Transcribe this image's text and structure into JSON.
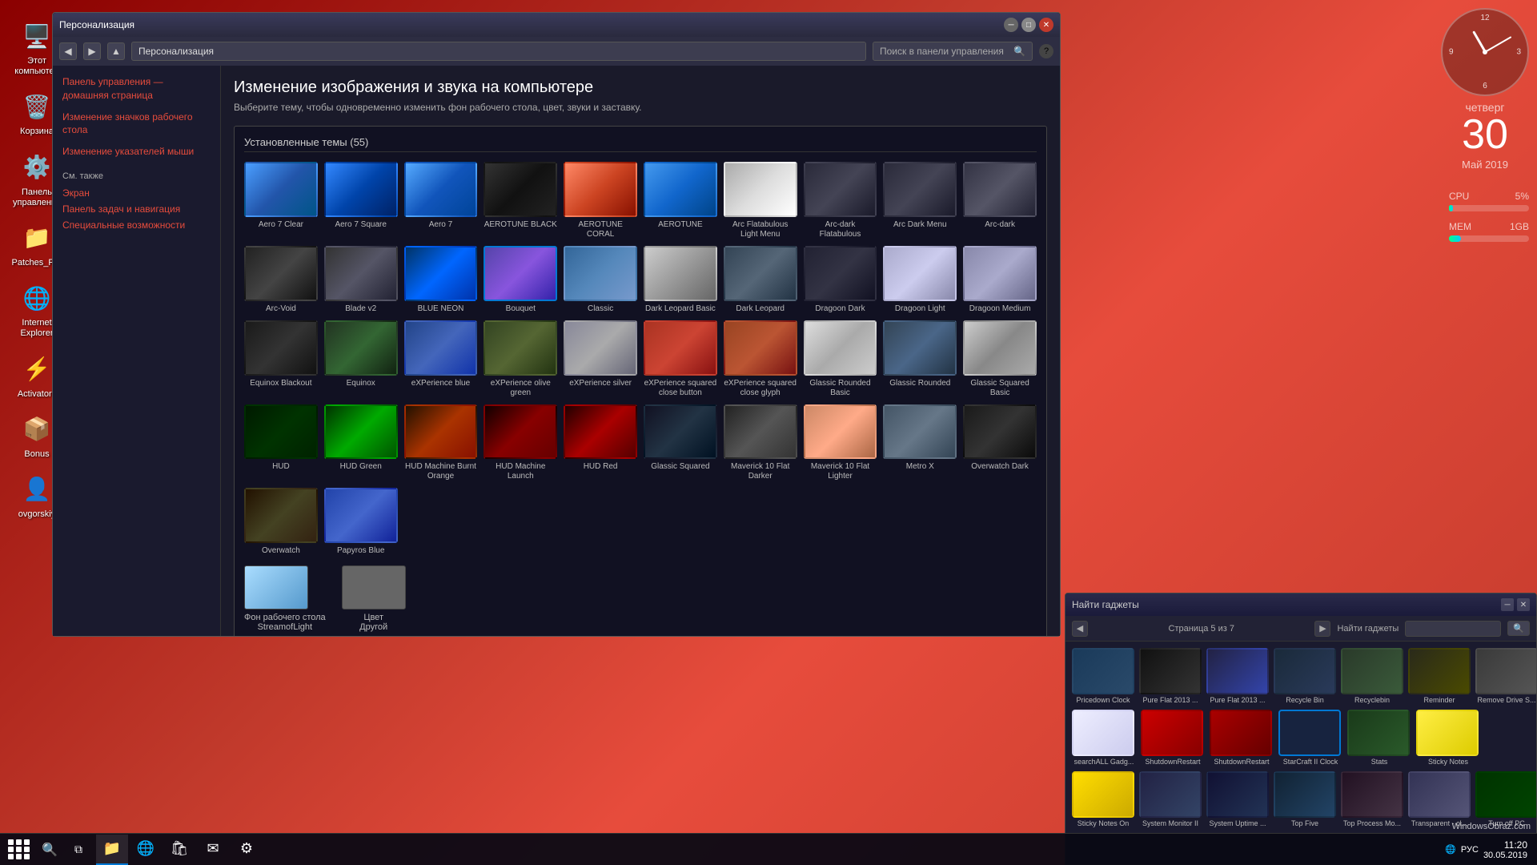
{
  "desktop": {
    "icons": [
      {
        "name": "this-computer",
        "label": "Этот компьютер",
        "icon": "🖥"
      },
      {
        "name": "basket",
        "label": "Корзина",
        "icon": "🗑"
      },
      {
        "name": "control-panel",
        "label": "Панель управления",
        "icon": "⚙"
      },
      {
        "name": "patches-fix",
        "label": "Patches_FIX",
        "icon": "📁"
      },
      {
        "name": "internet-explorer",
        "label": "Internet Explorer",
        "icon": "🌐"
      },
      {
        "name": "activators",
        "label": "Activators",
        "icon": "⚡"
      },
      {
        "name": "bonus",
        "label": "Bonus",
        "icon": "📦"
      },
      {
        "name": "ovgorskiy",
        "label": "ovgorskiy",
        "icon": "👤"
      }
    ]
  },
  "clock": {
    "day_label": "четверг",
    "date": "30",
    "month": "Май 2019"
  },
  "cpu": {
    "label": "CPU",
    "value": "5",
    "unit": "%",
    "fill_percent": 5
  },
  "mem": {
    "label": "MEM",
    "value": "1",
    "unit": "GB",
    "fill_percent": 15
  },
  "window": {
    "title": "Персонализация",
    "address": "Персонализация",
    "search_placeholder": "Поиск в панели управления",
    "help_btn": "?",
    "page_title": "Изменение изображения и звука на компьютере",
    "page_subtitle": "Выберите тему, чтобы одновременно изменить фон рабочего стола, цвет, звуки и заставку.",
    "themes_header": "Установленные темы (55)",
    "sidebar": {
      "home_link": "Панель управления — домашняя страница",
      "icons_link": "Изменение значков рабочего стола",
      "cursor_link": "Изменение указателей мыши",
      "see_also_label": "См. также",
      "screen_link": "Экран",
      "taskbar_link": "Панель задач и навигация",
      "accessibility_link": "Специальные возможности"
    },
    "themes": [
      {
        "id": "aero7clear",
        "name": "Aero 7 Clear",
        "css": "t-aero7clear",
        "selected": false
      },
      {
        "id": "aero7sq",
        "name": "Aero 7 Square",
        "css": "t-aero7sq",
        "selected": false
      },
      {
        "id": "aero7",
        "name": "Aero 7",
        "css": "t-aero7",
        "selected": false
      },
      {
        "id": "aeroblack",
        "name": "AEROTUNE BLACK",
        "css": "t-aeroblack",
        "selected": false
      },
      {
        "id": "aerocoral",
        "name": "AEROTUNE CORAL",
        "css": "t-aerocoral",
        "selected": false
      },
      {
        "id": "aerotune",
        "name": "AEROTUNE",
        "css": "t-aerotune",
        "selected": false
      },
      {
        "id": "arcflatlight",
        "name": "Arc Flatabulous Light Menu",
        "css": "t-arcflatlight",
        "selected": false
      },
      {
        "id": "arcdarkmenu",
        "name": "Arc-dark Flatabulous",
        "css": "t-arcdarkmenu",
        "selected": false
      },
      {
        "id": "arcdarkmenu2",
        "name": "Arc Dark Menu",
        "css": "t-arcdarkmenu",
        "selected": false
      },
      {
        "id": "arcdark",
        "name": "Arc-dark",
        "css": "t-arcdark",
        "selected": false
      },
      {
        "id": "arcvoid",
        "name": "Arc-Void",
        "css": "t-arcvoid",
        "selected": false
      },
      {
        "id": "bladev2",
        "name": "Blade v2",
        "css": "t-bladev2",
        "selected": false
      },
      {
        "id": "blueneon",
        "name": "BLUE NEON",
        "css": "t-blueneon",
        "selected": false
      },
      {
        "id": "bouquet",
        "name": "Bouquet",
        "css": "t-bouquet",
        "selected": true
      },
      {
        "id": "classic",
        "name": "Classic",
        "css": "t-classic",
        "selected": false
      },
      {
        "id": "darkleopbasic",
        "name": "Dark Leopard Basic",
        "css": "t-darkleopbasic",
        "selected": false
      },
      {
        "id": "darkleopard",
        "name": "Dark Leopard",
        "css": "t-darkleopard",
        "selected": false
      },
      {
        "id": "dragondark",
        "name": "Dragoon Dark",
        "css": "t-dragondark",
        "selected": false
      },
      {
        "id": "dragonlight",
        "name": "Dragoon Light",
        "css": "t-dragonlight",
        "selected": false
      },
      {
        "id": "dragonmed",
        "name": "Dragoon Medium",
        "css": "t-dragonmed",
        "selected": false
      },
      {
        "id": "equinoxblack",
        "name": "Equinox Blackout",
        "css": "t-equinoxblack",
        "selected": false
      },
      {
        "id": "equinox",
        "name": "Equinox",
        "css": "t-equinox",
        "selected": false
      },
      {
        "id": "expblue",
        "name": "eXPerience blue",
        "css": "t-expblue",
        "selected": false
      },
      {
        "id": "expolive",
        "name": "eXPerience olive green",
        "css": "t-expolive",
        "selected": false
      },
      {
        "id": "expsilver",
        "name": "eXPerience silver",
        "css": "t-expsilver",
        "selected": false
      },
      {
        "id": "expsqbutton",
        "name": "eXPerience squared close button",
        "css": "t-expsqbutton",
        "selected": false
      },
      {
        "id": "expsqglyph",
        "name": "eXPerience squared close glyph",
        "css": "t-expsqglyph",
        "selected": false
      },
      {
        "id": "glassicroundbasic",
        "name": "Glassic Rounded Basic",
        "css": "t-glassicroundbasic",
        "selected": false
      },
      {
        "id": "glassicround",
        "name": "Glassic Rounded",
        "css": "t-glassicround",
        "selected": false
      },
      {
        "id": "glassicsqbasic",
        "name": "Glassic Squared Basic",
        "css": "t-glassicsqbasic",
        "selected": false
      },
      {
        "id": "hud",
        "name": "HUD",
        "css": "t-hud",
        "selected": false
      },
      {
        "id": "hudgreen",
        "name": "HUD Green",
        "css": "t-hudgreen",
        "selected": false
      },
      {
        "id": "hudmachineburnt",
        "name": "HUD Machine Burnt Orange",
        "css": "t-hudmachineburnt",
        "selected": false
      },
      {
        "id": "hudmachinelaunch",
        "name": "HUD Machine Launch",
        "css": "t-hudmachinelaunch",
        "selected": false
      },
      {
        "id": "hudred",
        "name": "HUD Red",
        "css": "t-hudred",
        "selected": false
      },
      {
        "id": "glassicsq",
        "name": "Glassic Squared",
        "css": "t-glassicdark",
        "selected": false
      },
      {
        "id": "maverick10dark",
        "name": "Maverick 10 Flat Darker",
        "css": "t-maverick10dark",
        "selected": false
      },
      {
        "id": "maverick10light",
        "name": "Maverick 10 Flat Lighter",
        "css": "t-maverick10light",
        "selected": false
      },
      {
        "id": "metrox",
        "name": "Metro X",
        "css": "t-metrox",
        "selected": false
      },
      {
        "id": "overwatchdark",
        "name": "Overwatch Dark",
        "css": "t-overwatchdark",
        "selected": false
      },
      {
        "id": "overwatch",
        "name": "Overwatch",
        "css": "t-overwatch",
        "selected": false
      },
      {
        "id": "papyrosblue",
        "name": "Papyros Blue",
        "css": "t-papyrosblue",
        "selected": false
      }
    ],
    "wallpaper": {
      "name": "Фон рабочего стола",
      "sub": "StreamofLight"
    },
    "color": {
      "name": "Цвет",
      "sub": "Другой"
    }
  },
  "gadgets": {
    "title": "Найти гаджеты",
    "page_info": "Страница 5 из 7",
    "search_placeholder": "",
    "items_row1": [
      {
        "id": "pricedown-clock",
        "name": "Pricedown Clock",
        "css": "g-clock"
      },
      {
        "id": "pureflat2013a",
        "name": "Pure Flat 2013 ...",
        "css": "g-pureflat2013a"
      },
      {
        "id": "pureflat2013b",
        "name": "Pure Flat 2013 ...",
        "css": "g-pureflat2013b"
      },
      {
        "id": "recycle-bin",
        "name": "Recycle Bin",
        "css": "g-recyclebin"
      },
      {
        "id": "recyclebin2",
        "name": "Recyclebin",
        "css": "g-recyclebin2"
      },
      {
        "id": "reminder",
        "name": "Reminder",
        "css": "g-reminder"
      },
      {
        "id": "removedrive",
        "name": "Remove Drive S...",
        "css": "g-removedrive"
      }
    ],
    "items_row2": [
      {
        "id": "searchall",
        "name": "searchALL Gadg...",
        "css": "g-searchall"
      },
      {
        "id": "shutdown1",
        "name": "ShutdownRestart",
        "css": "g-shutdown"
      },
      {
        "id": "shutdown2",
        "name": "ShutdownRestart",
        "css": "g-shutdown2"
      },
      {
        "id": "starcraft-clock",
        "name": "StarCraft II Clock",
        "css": "g-starcraft",
        "selected": true
      },
      {
        "id": "stats",
        "name": "Stats",
        "css": "g-stats"
      },
      {
        "id": "stickynotes",
        "name": "Sticky Notes",
        "css": "g-stickynotes"
      }
    ],
    "items_row3": [
      {
        "id": "stickynoteson",
        "name": "Sticky Notes On",
        "css": "g-stickynoteson"
      },
      {
        "id": "sysmonitor",
        "name": "System Monitor II",
        "css": "g-sysmonitor"
      },
      {
        "id": "sysuptime",
        "name": "System Uptime ...",
        "css": "g-sysuptime"
      },
      {
        "id": "topfive",
        "name": "Top Five",
        "css": "g-topfive"
      },
      {
        "id": "topprocess",
        "name": "Top Process Mo...",
        "css": "g-toprocess"
      },
      {
        "id": "transparent",
        "name": "Transparent - cl...",
        "css": "g-transparent"
      },
      {
        "id": "turnoff",
        "name": "Turn off PC",
        "css": "g-turnoff"
      }
    ]
  },
  "taskbar": {
    "apps": [
      {
        "name": "start",
        "icon": "⊞"
      },
      {
        "name": "search",
        "icon": "🔍"
      },
      {
        "name": "task-view",
        "icon": "⧉"
      },
      {
        "name": "file-explorer",
        "icon": "📁"
      },
      {
        "name": "edge",
        "icon": "🌐"
      },
      {
        "name": "store",
        "icon": "🛍"
      },
      {
        "name": "mail",
        "icon": "✉"
      },
      {
        "name": "control-panel-app",
        "icon": "⚙"
      }
    ],
    "tray": {
      "time": "11:20",
      "date": "30.05.2019",
      "lang": "РУС"
    }
  },
  "watermark": "WindowsObraz.com"
}
